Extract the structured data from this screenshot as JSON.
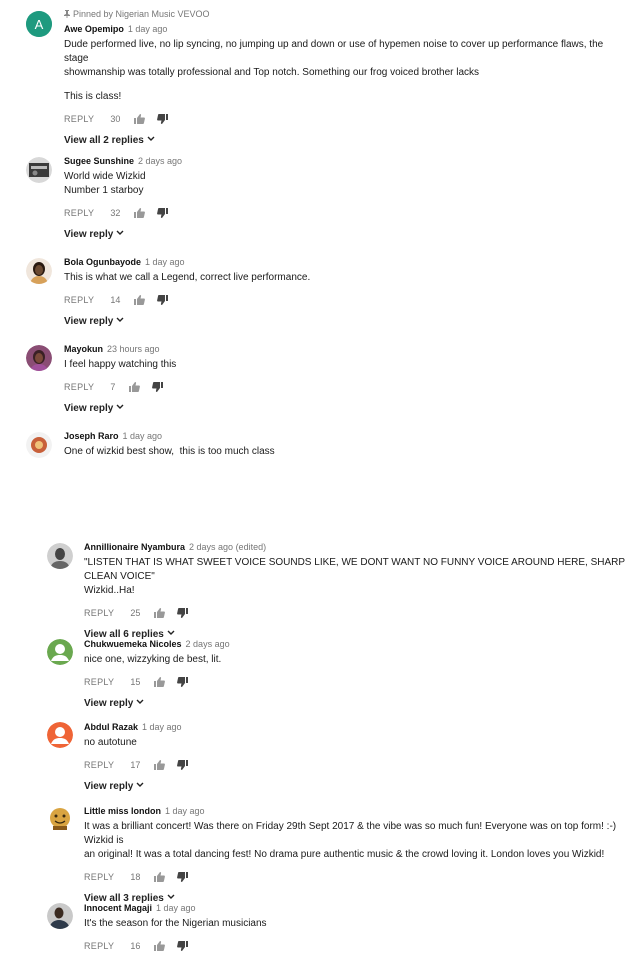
{
  "comments_a": [
    {
      "pinned_label": "Pinned by Nigerian Music VEVOO",
      "author": "Awe Opemipo",
      "time": "1 day ago",
      "avatar_letter": "A",
      "avatar_color": "#1e9a7f",
      "text_lines": [
        "Dude performed live, no lip syncing, no jumping up and down or use of hypemen noise to cover up performance flaws, the stage",
        "showmanship was totally professional and Top notch. Something our frog voiced brother lacks",
        "",
        "This is class!"
      ],
      "reply_label": "REPLY",
      "likes": "30",
      "view_replies": "View all 2 replies"
    },
    {
      "author": "Sugee Sunshine",
      "time": "2 days ago",
      "avatar_color": "#3a3a3a",
      "text_lines": [
        "World wide Wizkid",
        "Number 1 starboy"
      ],
      "reply_label": "REPLY",
      "likes": "32",
      "view_replies": "View reply"
    },
    {
      "author": "Bola Ogunbayode",
      "time": "1 day ago",
      "avatar_color": "#6b4a32",
      "text_lines": [
        "This is what we call a Legend, correct live performance."
      ],
      "reply_label": "REPLY",
      "likes": "14",
      "view_replies": "View reply"
    },
    {
      "author": "Mayokun",
      "time": "23 hours ago",
      "avatar_color": "#5a3548",
      "text_lines": [
        "I feel happy watching this"
      ],
      "reply_label": "REPLY",
      "likes": "7",
      "view_replies": "View reply"
    },
    {
      "author": "Joseph Raro",
      "time": "1 day ago",
      "avatar_color": "#c8603a",
      "text_lines": [
        "One of wizkid best show,  this is too much class"
      ]
    }
  ],
  "comments_b": [
    {
      "author": "Annillionaire Nyambura",
      "time": "2 days ago (edited)",
      "avatar_color": "#777777",
      "text_lines": [
        "\"LISTEN THAT IS WHAT SWEET VOICE SOUNDS LIKE, WE DONT WANT NO FUNNY VOICE AROUND HERE, SHARP CLEAN VOICE\"",
        "Wizkid..Ha!"
      ],
      "reply_label": "REPLY",
      "likes": "25",
      "view_replies": "View all 6 replies"
    },
    {
      "author": "Chukwuemeka Nicoles",
      "time": "2 days ago",
      "avatar_color": "#6aa84f",
      "text_lines": [
        "nice one, wizzyking de best, lit."
      ],
      "reply_label": "REPLY",
      "likes": "15",
      "view_replies": "View reply"
    },
    {
      "author": "Abdul Razak",
      "time": "1 day ago",
      "avatar_color": "#ef6436",
      "text_lines": [
        "no autotune"
      ],
      "reply_label": "REPLY",
      "likes": "17",
      "view_replies": "View reply"
    },
    {
      "author": "Little miss london",
      "time": "1 day ago",
      "avatar_color": "#d9a441",
      "text_lines": [
        "It was a brilliant concert! Was there on Friday 29th Sept 2017 & the vibe was so much fun! Everyone was on top form! :-) Wizkid is",
        "an original! It was a total dancing fest! No drama pure authentic music & the crowd loving it. London loves you Wizkid!"
      ],
      "reply_label": "REPLY",
      "likes": "18",
      "view_replies": "View all 3 replies"
    },
    {
      "author": "Innocent Magaji",
      "time": "1 day ago",
      "avatar_color": "#4a4a4a",
      "text_lines": [
        "It's the season for the Nigerian musicians"
      ],
      "reply_label": "REPLY",
      "likes": "16"
    }
  ]
}
